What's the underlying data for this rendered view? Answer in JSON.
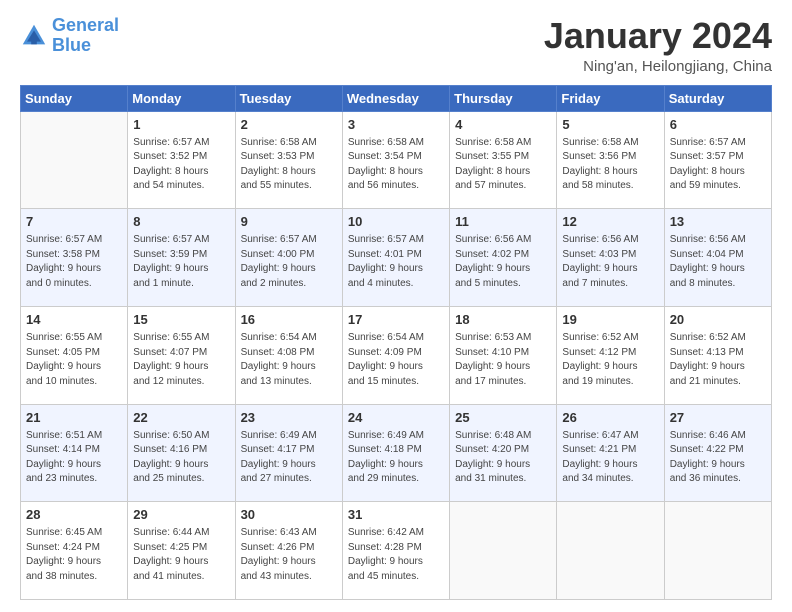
{
  "header": {
    "logo_general": "General",
    "logo_blue": "Blue",
    "month": "January 2024",
    "location": "Ning'an, Heilongjiang, China"
  },
  "weekdays": [
    "Sunday",
    "Monday",
    "Tuesday",
    "Wednesday",
    "Thursday",
    "Friday",
    "Saturday"
  ],
  "weeks": [
    [
      {
        "day": "",
        "info": ""
      },
      {
        "day": "1",
        "info": "Sunrise: 6:57 AM\nSunset: 3:52 PM\nDaylight: 8 hours\nand 54 minutes."
      },
      {
        "day": "2",
        "info": "Sunrise: 6:58 AM\nSunset: 3:53 PM\nDaylight: 8 hours\nand 55 minutes."
      },
      {
        "day": "3",
        "info": "Sunrise: 6:58 AM\nSunset: 3:54 PM\nDaylight: 8 hours\nand 56 minutes."
      },
      {
        "day": "4",
        "info": "Sunrise: 6:58 AM\nSunset: 3:55 PM\nDaylight: 8 hours\nand 57 minutes."
      },
      {
        "day": "5",
        "info": "Sunrise: 6:58 AM\nSunset: 3:56 PM\nDaylight: 8 hours\nand 58 minutes."
      },
      {
        "day": "6",
        "info": "Sunrise: 6:57 AM\nSunset: 3:57 PM\nDaylight: 8 hours\nand 59 minutes."
      }
    ],
    [
      {
        "day": "7",
        "info": "Sunrise: 6:57 AM\nSunset: 3:58 PM\nDaylight: 9 hours\nand 0 minutes."
      },
      {
        "day": "8",
        "info": "Sunrise: 6:57 AM\nSunset: 3:59 PM\nDaylight: 9 hours\nand 1 minute."
      },
      {
        "day": "9",
        "info": "Sunrise: 6:57 AM\nSunset: 4:00 PM\nDaylight: 9 hours\nand 2 minutes."
      },
      {
        "day": "10",
        "info": "Sunrise: 6:57 AM\nSunset: 4:01 PM\nDaylight: 9 hours\nand 4 minutes."
      },
      {
        "day": "11",
        "info": "Sunrise: 6:56 AM\nSunset: 4:02 PM\nDaylight: 9 hours\nand 5 minutes."
      },
      {
        "day": "12",
        "info": "Sunrise: 6:56 AM\nSunset: 4:03 PM\nDaylight: 9 hours\nand 7 minutes."
      },
      {
        "day": "13",
        "info": "Sunrise: 6:56 AM\nSunset: 4:04 PM\nDaylight: 9 hours\nand 8 minutes."
      }
    ],
    [
      {
        "day": "14",
        "info": "Sunrise: 6:55 AM\nSunset: 4:05 PM\nDaylight: 9 hours\nand 10 minutes."
      },
      {
        "day": "15",
        "info": "Sunrise: 6:55 AM\nSunset: 4:07 PM\nDaylight: 9 hours\nand 12 minutes."
      },
      {
        "day": "16",
        "info": "Sunrise: 6:54 AM\nSunset: 4:08 PM\nDaylight: 9 hours\nand 13 minutes."
      },
      {
        "day": "17",
        "info": "Sunrise: 6:54 AM\nSunset: 4:09 PM\nDaylight: 9 hours\nand 15 minutes."
      },
      {
        "day": "18",
        "info": "Sunrise: 6:53 AM\nSunset: 4:10 PM\nDaylight: 9 hours\nand 17 minutes."
      },
      {
        "day": "19",
        "info": "Sunrise: 6:52 AM\nSunset: 4:12 PM\nDaylight: 9 hours\nand 19 minutes."
      },
      {
        "day": "20",
        "info": "Sunrise: 6:52 AM\nSunset: 4:13 PM\nDaylight: 9 hours\nand 21 minutes."
      }
    ],
    [
      {
        "day": "21",
        "info": "Sunrise: 6:51 AM\nSunset: 4:14 PM\nDaylight: 9 hours\nand 23 minutes."
      },
      {
        "day": "22",
        "info": "Sunrise: 6:50 AM\nSunset: 4:16 PM\nDaylight: 9 hours\nand 25 minutes."
      },
      {
        "day": "23",
        "info": "Sunrise: 6:49 AM\nSunset: 4:17 PM\nDaylight: 9 hours\nand 27 minutes."
      },
      {
        "day": "24",
        "info": "Sunrise: 6:49 AM\nSunset: 4:18 PM\nDaylight: 9 hours\nand 29 minutes."
      },
      {
        "day": "25",
        "info": "Sunrise: 6:48 AM\nSunset: 4:20 PM\nDaylight: 9 hours\nand 31 minutes."
      },
      {
        "day": "26",
        "info": "Sunrise: 6:47 AM\nSunset: 4:21 PM\nDaylight: 9 hours\nand 34 minutes."
      },
      {
        "day": "27",
        "info": "Sunrise: 6:46 AM\nSunset: 4:22 PM\nDaylight: 9 hours\nand 36 minutes."
      }
    ],
    [
      {
        "day": "28",
        "info": "Sunrise: 6:45 AM\nSunset: 4:24 PM\nDaylight: 9 hours\nand 38 minutes."
      },
      {
        "day": "29",
        "info": "Sunrise: 6:44 AM\nSunset: 4:25 PM\nDaylight: 9 hours\nand 41 minutes."
      },
      {
        "day": "30",
        "info": "Sunrise: 6:43 AM\nSunset: 4:26 PM\nDaylight: 9 hours\nand 43 minutes."
      },
      {
        "day": "31",
        "info": "Sunrise: 6:42 AM\nSunset: 4:28 PM\nDaylight: 9 hours\nand 45 minutes."
      },
      {
        "day": "",
        "info": ""
      },
      {
        "day": "",
        "info": ""
      },
      {
        "day": "",
        "info": ""
      }
    ]
  ]
}
